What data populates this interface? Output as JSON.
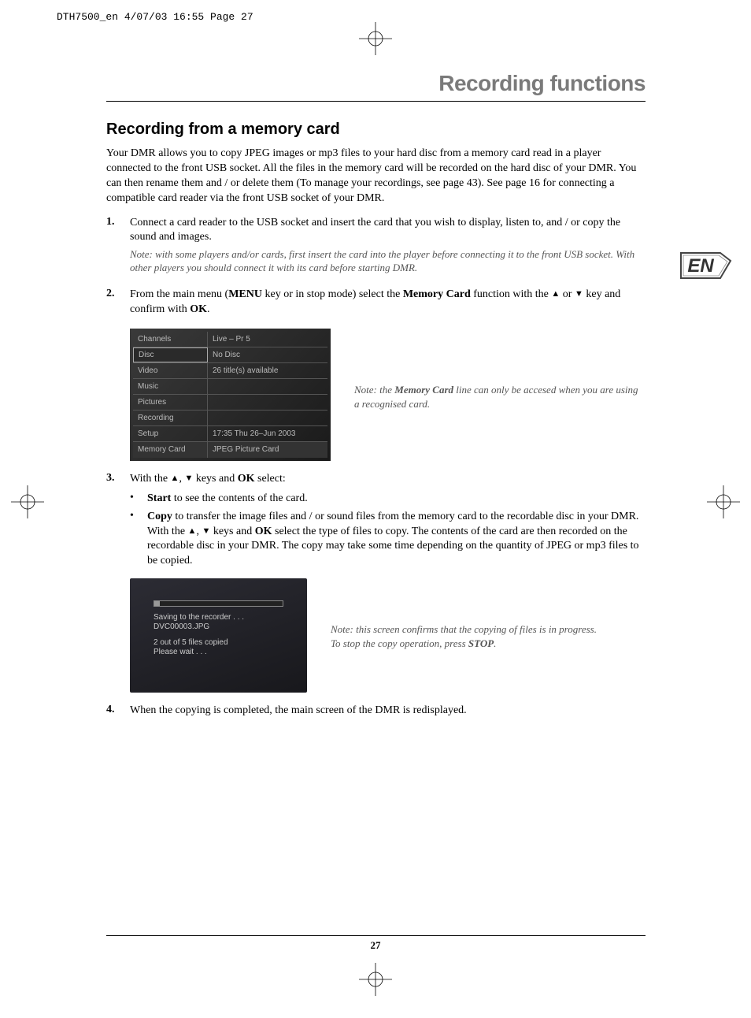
{
  "slug": "DTH7500_en  4/07/03  16:55  Page 27",
  "chapter_title": "Recording functions",
  "section_title": "Recording from a memory card",
  "intro": "Your DMR allows you to copy JPEG images or mp3 files to your hard disc from a memory card read in a player connected to the front USB socket. All the files in the memory card will be recorded on the hard disc of your DMR. You can then rename them and / or delete them (To manage your recordings, see page 43). See page 16 for connecting a compatible card reader via the front USB socket of your DMR.",
  "step1": {
    "num": "1.",
    "text": "Connect a card reader to the USB socket and insert the card that you wish to display, listen to, and / or copy the sound and images.",
    "note": "Note: with some players and/or cards, first insert the card into the player before connecting it to the front USB socket. With other players you should connect it with its card before starting DMR."
  },
  "step2": {
    "num": "2.",
    "pre": "From the main menu (",
    "menu_key": "MENU",
    "mid1": " key or in stop mode) select the ",
    "memory_card": "Memory Card",
    "mid2": " function with the ",
    "or": " or ",
    "mid3": " key and confirm with ",
    "ok": "OK",
    "end": "."
  },
  "menu": {
    "rows": [
      {
        "left": "Channels",
        "right": "Live – Pr 5"
      },
      {
        "left": "Disc",
        "right": "No Disc"
      },
      {
        "left": "Video",
        "right": "26 title(s) available"
      },
      {
        "left": "Music",
        "right": ""
      },
      {
        "left": "Pictures",
        "right": ""
      },
      {
        "left": "Recording",
        "right": ""
      },
      {
        "left": "Setup",
        "right": "17:35 Thu 26–Jun 2003"
      },
      {
        "left": "Memory Card",
        "right": "JPEG Picture Card"
      }
    ]
  },
  "menu_note": {
    "pre": "Note: the ",
    "bold": "Memory Card",
    "post": " line can only be accesed when you are using a recognised card."
  },
  "step3": {
    "num": "3.",
    "pre": "With the ",
    "comma": ", ",
    "mid": " keys and ",
    "ok": "OK",
    "post": " select:"
  },
  "bullet_start": {
    "bold": "Start",
    "text": " to see the contents of the card."
  },
  "bullet_copy": {
    "bold": "Copy",
    "t1": " to transfer the image files and / or sound files from the memory card to the recordable disc in your DMR. With the ",
    "comma": ", ",
    "t2": " keys and ",
    "ok": "OK",
    "t3": " select the type of files to copy. The contents of the card are then recorded on the recordable disc in your DMR. The copy may take some time depending on the quantity of JPEG or mp3 files to be copied."
  },
  "progress": {
    "line1": "Saving to the recorder . . .",
    "line2": "DVC00003.JPG",
    "line3": "2 out of 5 files copied",
    "line4": "Please wait . . ."
  },
  "progress_note": {
    "line1": "Note: this screen confirms that the copying of files is in progress.",
    "pre2": "To stop the copy operation, press ",
    "bold": "STOP",
    "post2": "."
  },
  "step4": {
    "num": "4.",
    "text": "When the copying is completed, the main screen of the DMR is redisplayed."
  },
  "page_number": "27",
  "badge": "EN"
}
